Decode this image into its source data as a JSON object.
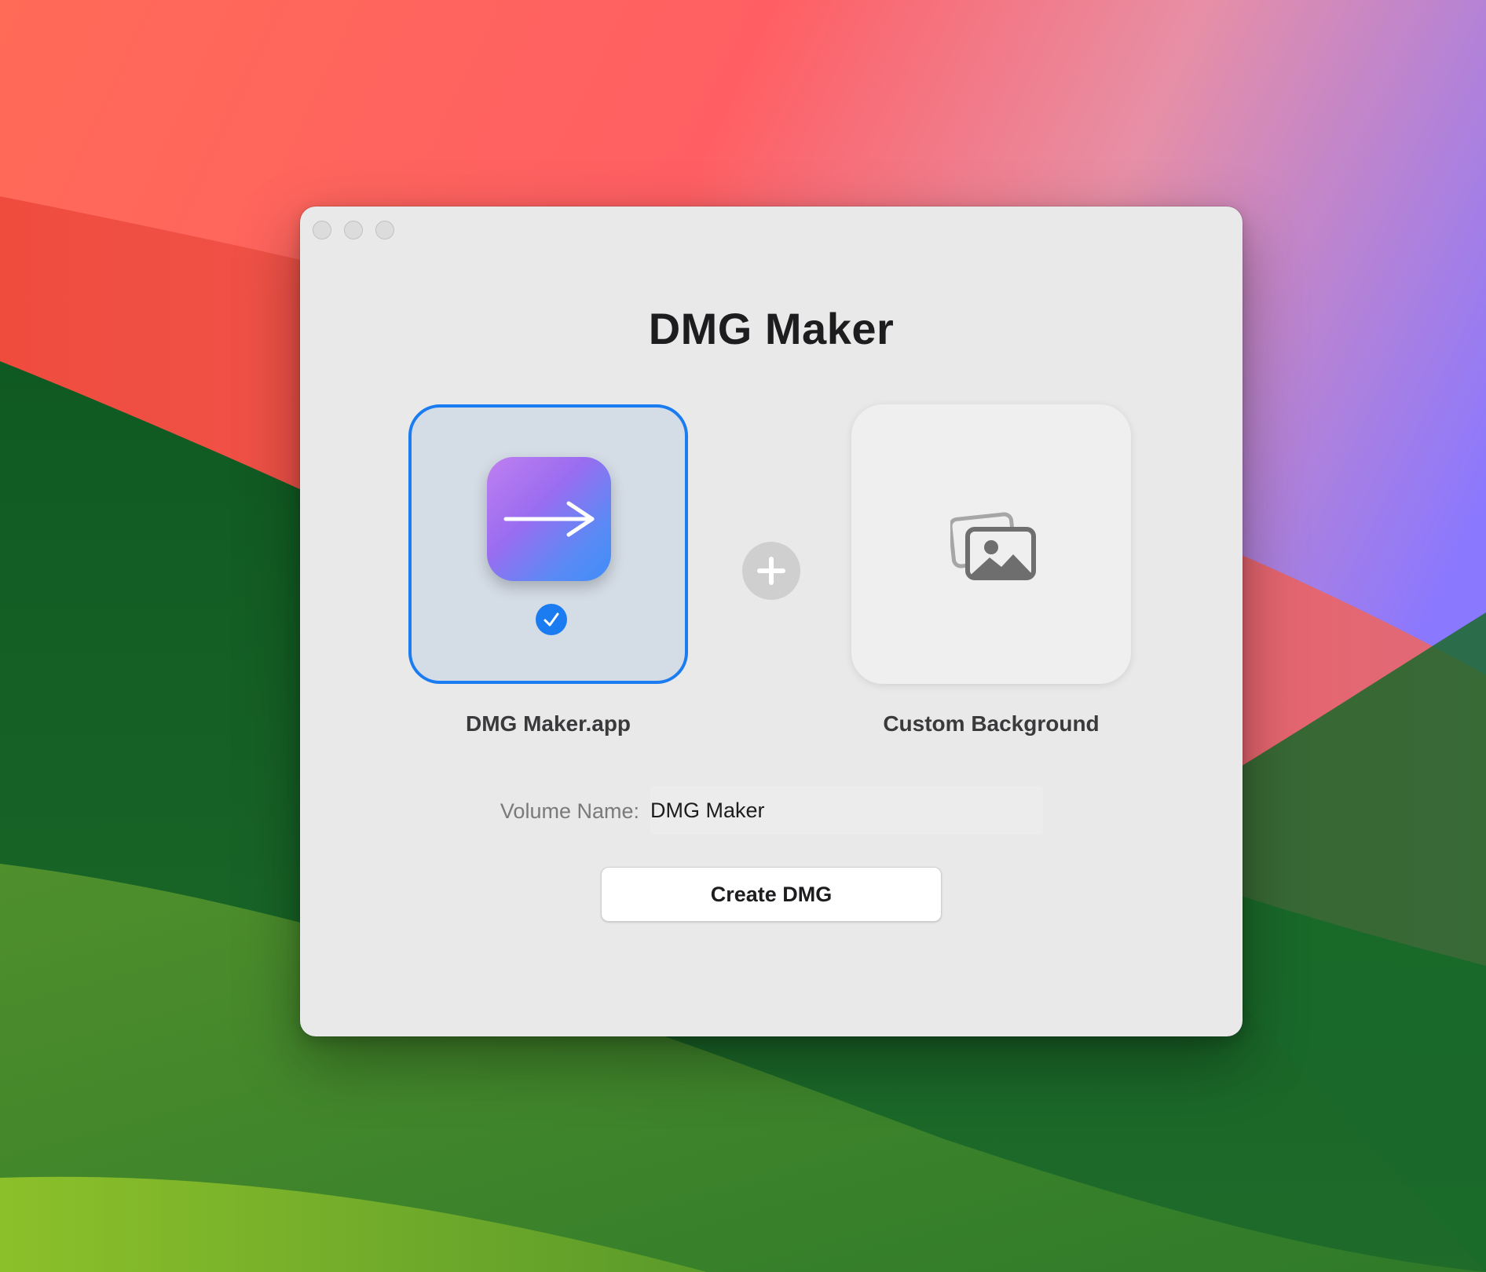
{
  "window": {
    "title": "DMG Maker",
    "controls": [
      "close-button",
      "minimize-button",
      "zoom-button"
    ]
  },
  "app_well": {
    "label": "DMG Maker.app",
    "selected": true,
    "icon": "arrow-right-icon",
    "accent_color": "#1a7cf0"
  },
  "add_icon": "plus-circle-icon",
  "background_well": {
    "label": "Custom Background",
    "icon": "photo-stack-icon"
  },
  "volume": {
    "label": "Volume Name:",
    "value": "DMG Maker"
  },
  "actions": {
    "create_label": "Create DMG"
  }
}
